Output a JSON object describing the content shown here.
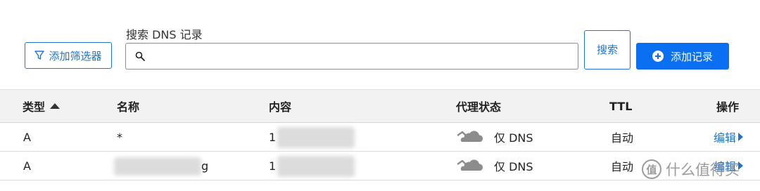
{
  "toolbar": {
    "filter_label": "添加筛选器",
    "search_label": "搜索 DNS 记录",
    "search_value": "",
    "search_placeholder": "",
    "search_button_label": "搜索",
    "add_record_label": "添加记录"
  },
  "table": {
    "columns": [
      "类型",
      "名称",
      "内容",
      "代理状态",
      "TTL",
      "操作"
    ],
    "rows": [
      {
        "type": "A",
        "name": "*",
        "content": "1",
        "proxy_status": "仅 DNS",
        "ttl": "自动",
        "action": "编辑"
      },
      {
        "type": "A",
        "name": "g",
        "content": "1",
        "proxy_status": "仅 DNS",
        "ttl": "自动",
        "action": "编辑"
      }
    ]
  },
  "watermark": {
    "text": "什么值得买",
    "badge": "值"
  },
  "colors": {
    "accent": "#1f74d1",
    "primary_button": "#0a6ff0",
    "header_bg": "#f2f2f2",
    "cloud_icon": "#8c8c8c"
  },
  "icons": [
    "filter-icon",
    "search-icon",
    "plus-circle-icon",
    "sort-ascending-icon",
    "cloud-dns-only-icon",
    "caret-right-icon"
  ]
}
